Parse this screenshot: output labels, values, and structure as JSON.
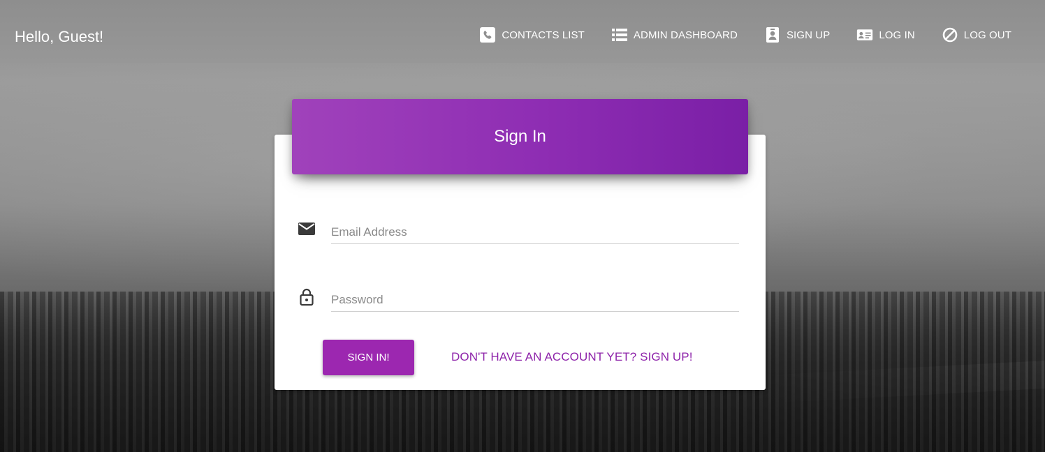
{
  "navbar": {
    "greeting": "Hello, Guest!",
    "links": [
      {
        "label": "CONTACTS LIST",
        "icon": "phone-icon"
      },
      {
        "label": "ADMIN DASHBOARD",
        "icon": "list-icon"
      },
      {
        "label": "SIGN UP",
        "icon": "person-badge-icon"
      },
      {
        "label": "LOG IN",
        "icon": "id-card-icon"
      },
      {
        "label": "LOG OUT",
        "icon": "block-icon"
      }
    ]
  },
  "form": {
    "title": "Sign In",
    "email": {
      "value": "",
      "placeholder": "Email Address",
      "icon": "mail-icon"
    },
    "password": {
      "value": "",
      "placeholder": "Password",
      "icon": "lock-icon"
    },
    "submit_label": "SIGN IN!",
    "signup_link": "DON'T HAVE AN ACCOUNT YET? SIGN UP!"
  },
  "colors": {
    "accent": "#9c27b0",
    "header_gradient_start": "#a042bb",
    "header_gradient_end": "#7a1fa6",
    "link": "#8e24aa"
  }
}
